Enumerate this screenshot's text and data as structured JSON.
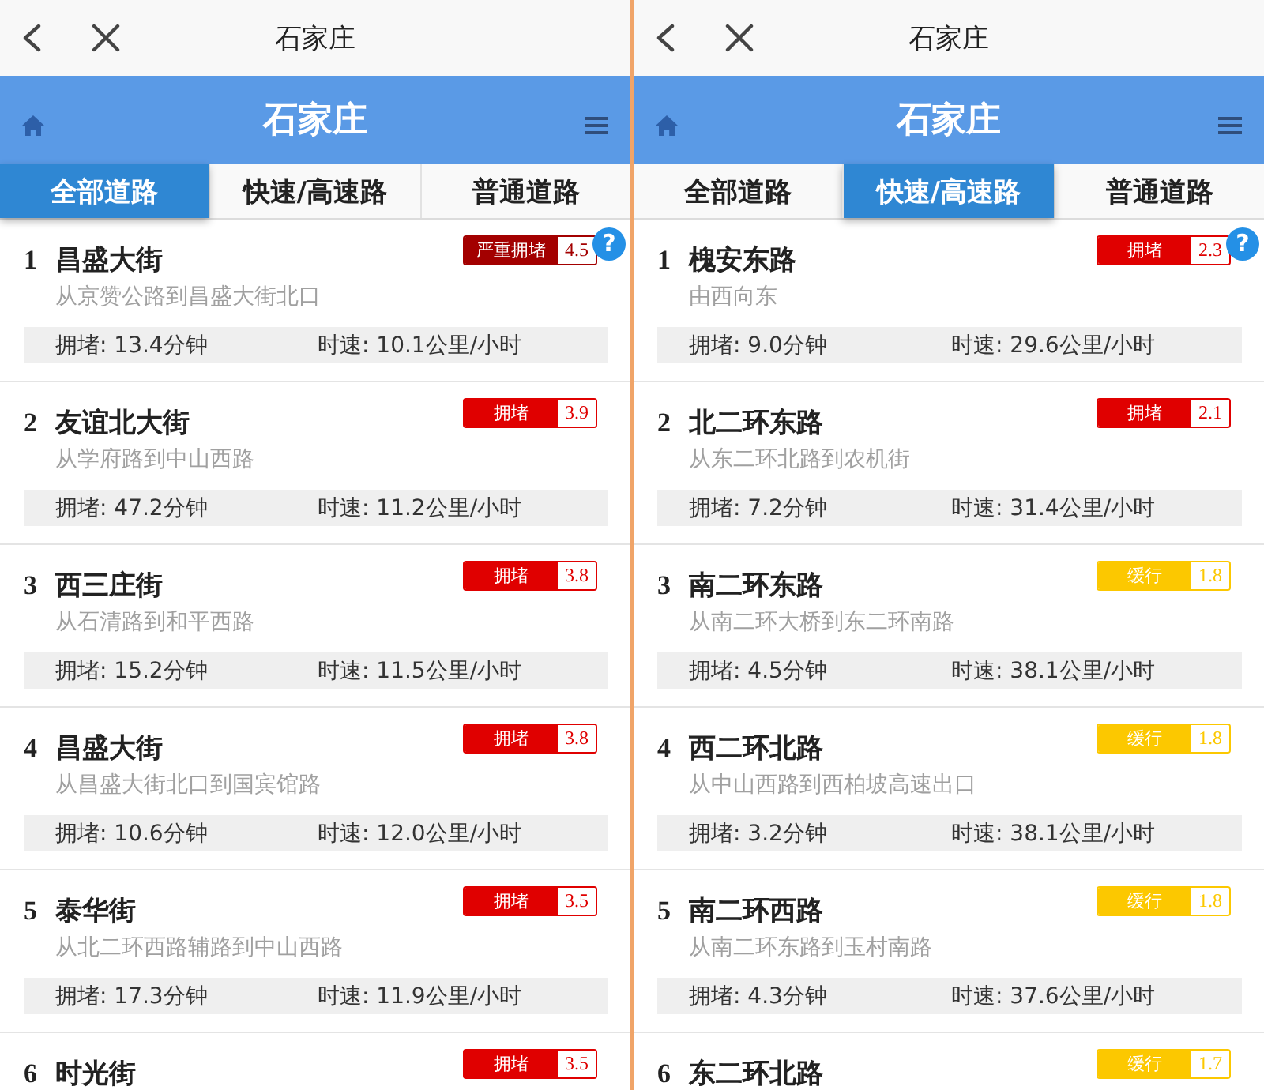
{
  "panels": [
    {
      "nav": {
        "title": "石家庄"
      },
      "header": {
        "title": "石家庄"
      },
      "tabs": [
        {
          "label": "全部道路",
          "selected": true
        },
        {
          "label": "快速/高速路",
          "selected": false
        },
        {
          "label": "普通道路",
          "selected": false
        }
      ],
      "roads": [
        {
          "rank": "1",
          "name": "昌盛大街",
          "route": "从京赞公路到昌盛大街北口",
          "delay": "拥堵: 13.4分钟",
          "speed": "时速: 10.1公里/小时",
          "status": {
            "label": "严重拥堵",
            "index": "4.5",
            "color": "#a30000"
          },
          "help": "?"
        },
        {
          "rank": "2",
          "name": "友谊北大街",
          "route": "从学府路到中山西路",
          "delay": "拥堵: 47.2分钟",
          "speed": "时速: 11.2公里/小时",
          "status": {
            "label": "拥堵",
            "index": "3.9",
            "color": "#e00000"
          }
        },
        {
          "rank": "3",
          "name": "西三庄街",
          "route": "从石清路到和平西路",
          "delay": "拥堵: 15.2分钟",
          "speed": "时速: 11.5公里/小时",
          "status": {
            "label": "拥堵",
            "index": "3.8",
            "color": "#e00000"
          }
        },
        {
          "rank": "4",
          "name": "昌盛大街",
          "route": "从昌盛大街北口到国宾馆路",
          "delay": "拥堵: 10.6分钟",
          "speed": "时速: 12.0公里/小时",
          "status": {
            "label": "拥堵",
            "index": "3.8",
            "color": "#e00000"
          }
        },
        {
          "rank": "5",
          "name": "泰华街",
          "route": "从北二环西路辅路到中山西路",
          "delay": "拥堵: 17.3分钟",
          "speed": "时速: 11.9公里/小时",
          "status": {
            "label": "拥堵",
            "index": "3.5",
            "color": "#e00000"
          }
        },
        {
          "rank": "6",
          "name": "时光街",
          "status": {
            "label": "拥堵",
            "index": "3.5",
            "color": "#e00000"
          }
        }
      ]
    },
    {
      "nav": {
        "title": "石家庄"
      },
      "header": {
        "title": "石家庄"
      },
      "tabs": [
        {
          "label": "全部道路",
          "selected": false
        },
        {
          "label": "快速/高速路",
          "selected": true
        },
        {
          "label": "普通道路",
          "selected": false
        }
      ],
      "roads": [
        {
          "rank": "1",
          "name": "槐安东路",
          "route": "由西向东",
          "delay": "拥堵: 9.0分钟",
          "speed": "时速: 29.6公里/小时",
          "status": {
            "label": "拥堵",
            "index": "2.3",
            "color": "#e00000"
          },
          "help": "?"
        },
        {
          "rank": "2",
          "name": "北二环东路",
          "route": "从东二环北路到农机街",
          "delay": "拥堵: 7.2分钟",
          "speed": "时速: 31.4公里/小时",
          "status": {
            "label": "拥堵",
            "index": "2.1",
            "color": "#e00000"
          }
        },
        {
          "rank": "3",
          "name": "南二环东路",
          "route": "从南二环大桥到东二环南路",
          "delay": "拥堵: 4.5分钟",
          "speed": "时速: 38.1公里/小时",
          "status": {
            "label": "缓行",
            "index": "1.8",
            "color": "#fcc800"
          }
        },
        {
          "rank": "4",
          "name": "西二环北路",
          "route": "从中山西路到西柏坡高速出口",
          "delay": "拥堵: 3.2分钟",
          "speed": "时速: 38.1公里/小时",
          "status": {
            "label": "缓行",
            "index": "1.8",
            "color": "#fcc800"
          }
        },
        {
          "rank": "5",
          "name": "南二环西路",
          "route": "从南二环东路到玉村南路",
          "delay": "拥堵: 4.3分钟",
          "speed": "时速: 37.6公里/小时",
          "status": {
            "label": "缓行",
            "index": "1.8",
            "color": "#fcc800"
          }
        },
        {
          "rank": "6",
          "name": "东二环北路",
          "status": {
            "label": "缓行",
            "index": "1.7",
            "color": "#fcc800"
          }
        }
      ]
    }
  ]
}
